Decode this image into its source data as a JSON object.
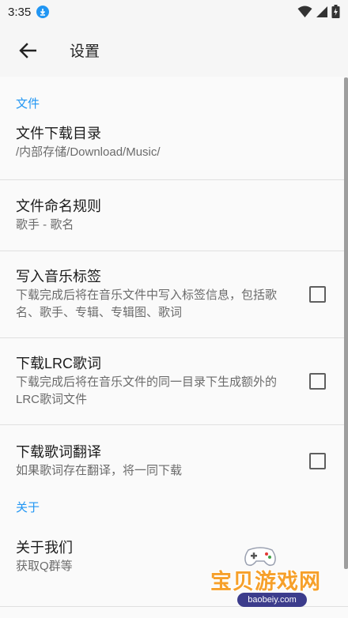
{
  "status_bar": {
    "time": "3:35",
    "icons": [
      "download-icon",
      "wifi-icon",
      "cellular-icon",
      "battery-charging-icon"
    ]
  },
  "app_bar": {
    "back_icon": "arrow-back-icon",
    "title": "设置"
  },
  "sections": {
    "file": {
      "header": "文件",
      "download_dir": {
        "title": "文件下载目录",
        "summary": "/内部存储/Download/Music/"
      },
      "naming_rule": {
        "title": "文件命名规则",
        "summary": "歌手 - 歌名"
      },
      "write_tags": {
        "title": "写入音乐标签",
        "summary": "下载完成后将在音乐文件中写入标签信息，包括歌名、歌手、专辑、专辑图、歌词",
        "checked": false
      },
      "download_lrc": {
        "title": "下载LRC歌词",
        "summary": "下载完成后将在音乐文件的同一目录下生成额外的LRC歌词文件",
        "checked": false
      },
      "download_translation": {
        "title": "下载歌词翻译",
        "summary": "如果歌词存在翻译，将一同下载",
        "checked": false
      }
    },
    "about": {
      "header": "关于",
      "about_us": {
        "title": "关于我们",
        "summary": "获取Q群等"
      }
    }
  },
  "watermark": {
    "text": "宝贝游戏网",
    "domain": "baobeiy.com"
  },
  "colors": {
    "accent": "#2196f3",
    "background": "#fafafa",
    "bar": "#f6f6f6",
    "divider": "#e0e0e0"
  }
}
